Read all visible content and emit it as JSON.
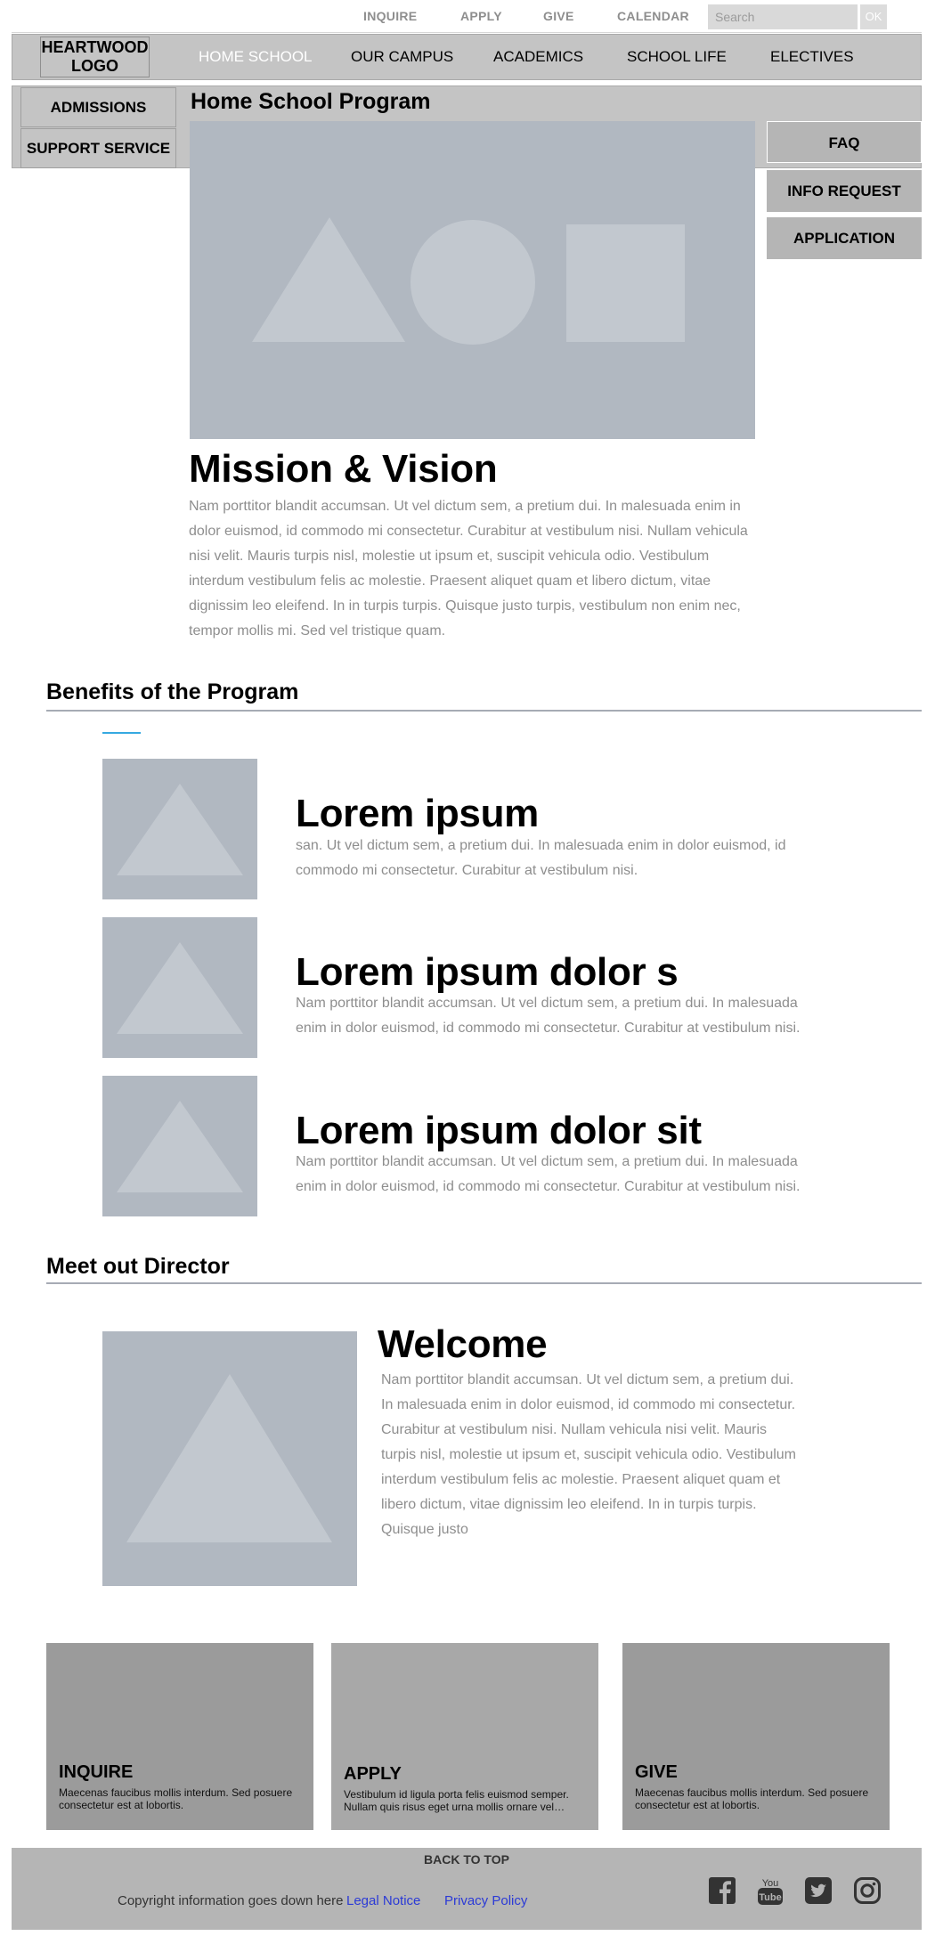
{
  "utility_nav": [
    "INQUIRE",
    "APPLY",
    "GIVE",
    "CALENDAR"
  ],
  "search": {
    "placeholder": "Search",
    "button": "OK"
  },
  "logo": {
    "line1": "HEARTWOOD",
    "line2": "LOGO"
  },
  "main_nav": {
    "items": [
      "HOME SCHOOL",
      "OUR CAMPUS",
      "ACADEMICS",
      "SCHOOL LIFE",
      "ELECTIVES"
    ],
    "active_index": 0
  },
  "side_nav": [
    "ADMISSIONS",
    "SUPPORT SERVICE"
  ],
  "page_title": "Home School Program",
  "quick_links": [
    "FAQ",
    "INFO REQUEST",
    "APPLICATION"
  ],
  "mission": {
    "heading": "Mission & Vision",
    "body": "Nam porttitor blandit accumsan. Ut vel dictum sem, a pretium dui. In malesuada enim in dolor euismod, id commodo mi consectetur. Curabitur at vestibulum nisi. Nullam vehicula nisi velit. Mauris turpis nisl, molestie ut ipsum et, suscipit vehicula odio. Vestibulum interdum vestibulum felis ac molestie. Praesent aliquet quam et libero dictum, vitae dignissim leo eleifend. In in turpis turpis. Quisque justo turpis, vestibulum non enim nec, tempor mollis mi. Sed vel tristique quam."
  },
  "benefits": {
    "heading": "Benefits of the Program",
    "items": [
      {
        "title": "Lorem ipsum",
        "body": "san. Ut vel dictum sem, a pretium dui. In malesuada enim in dolor euismod, id commodo mi consectetur. Curabitur at vestibulum nisi."
      },
      {
        "title": "Lorem ipsum dolor s",
        "body": "Nam porttitor blandit accumsan. Ut vel dictum sem, a pretium dui. In malesuada enim in dolor euismod, id commodo mi consectetur. Curabitur at vestibulum nisi."
      },
      {
        "title": "Lorem ipsum dolor sit",
        "body": "Nam porttitor blandit accumsan. Ut vel dictum sem, a pretium dui. In malesuada enim in dolor euismod, id commodo mi consectetur. Curabitur at vestibulum nisi."
      }
    ]
  },
  "director": {
    "heading": "Meet out Director",
    "welcome": "Welcome",
    "body": "Nam porttitor blandit accumsan. Ut vel dictum sem, a pretium dui. In malesuada enim in dolor euismod, id commodo mi consectetur. Curabitur at vestibulum nisi. Nullam vehicula nisi velit. Mauris turpis nisl, molestie ut ipsum et, suscipit vehicula odio. Vestibulum interdum vestibulum felis ac molestie. Praesent aliquet quam et libero dictum, vitae dignissim leo eleifend. In in turpis turpis. Quisque justo"
  },
  "cta_cards": [
    {
      "title": "INQUIRE",
      "text": "Maecenas faucibus mollis interdum. Sed posuere consectetur est at lobortis."
    },
    {
      "title": "APPLY",
      "text": "Vestibulum id ligula porta felis euismod semper. Nullam quis risus eget urna mollis ornare vel…"
    },
    {
      "title": "GIVE",
      "text": "Maecenas faucibus mollis interdum. Sed posuere consectetur est at lobortis."
    }
  ],
  "footer": {
    "back_to_top": "BACK TO TOP",
    "copyright": "Copyright information goes down here",
    "links": [
      "Legal Notice",
      "Privacy Policy"
    ],
    "social_icons": [
      "facebook-icon",
      "youtube-icon",
      "twitter-icon",
      "instagram-icon"
    ]
  },
  "colors": {
    "nav_bg": "#c4c4c4",
    "placeholder_image": "#b1b8c1",
    "placeholder_shape": "#c2c8cf",
    "body_text": "#8e8e8e",
    "accent": "#36a9e1",
    "link": "#2b3ad6",
    "card_dark": "#9b9b9b",
    "card_light": "#a8a8a8"
  }
}
